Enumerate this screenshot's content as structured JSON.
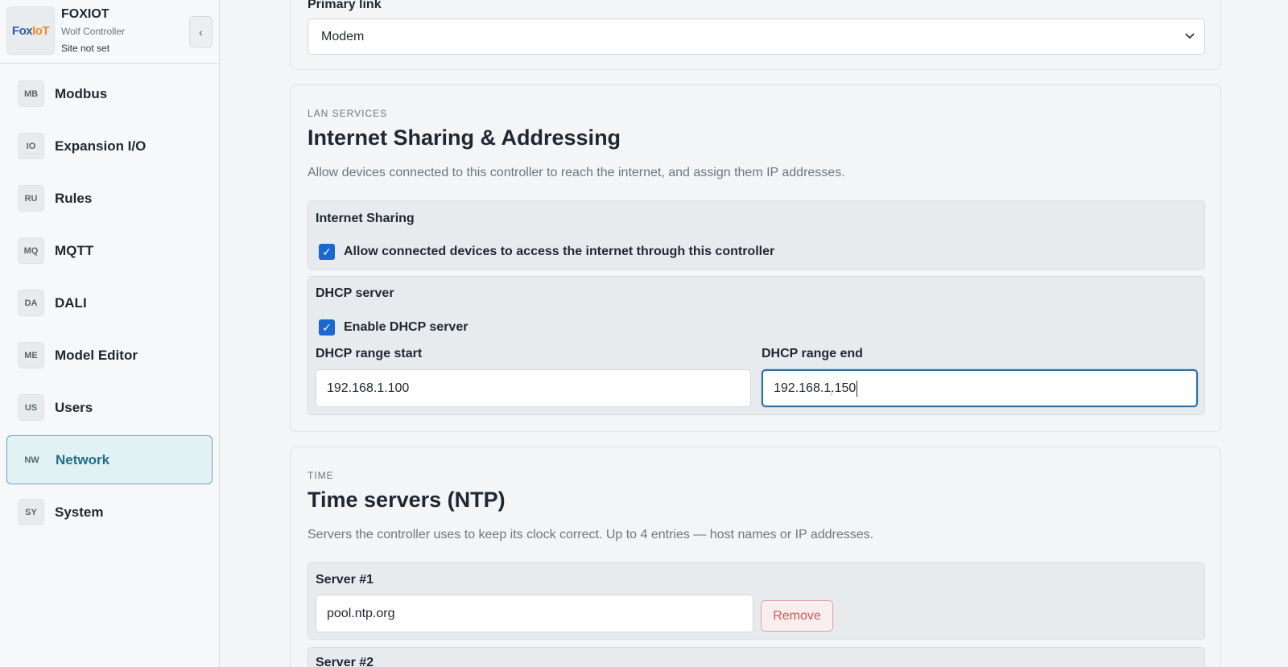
{
  "sidebar": {
    "brand": {
      "logo_part1": "Fox",
      "logo_part2": "IoT",
      "name": "FOXIOT",
      "subtitle": "Wolf Controller",
      "site": "Site not set",
      "collapse_icon": "‹"
    },
    "items": [
      {
        "abbr": "MB",
        "label": "Modbus"
      },
      {
        "abbr": "IO",
        "label": "Expansion I/O"
      },
      {
        "abbr": "RU",
        "label": "Rules"
      },
      {
        "abbr": "MQ",
        "label": "MQTT"
      },
      {
        "abbr": "DA",
        "label": "DALI"
      },
      {
        "abbr": "ME",
        "label": "Model Editor"
      },
      {
        "abbr": "US",
        "label": "Users"
      },
      {
        "abbr": "NW",
        "label": "Network"
      },
      {
        "abbr": "SY",
        "label": "System"
      }
    ],
    "active_item": "Network"
  },
  "primary_link": {
    "label": "Primary link",
    "selected": "Modem"
  },
  "lan": {
    "eyebrow": "LAN SERVICES",
    "title": "Internet Sharing & Addressing",
    "description": "Allow devices connected to this controller to reach the internet, and assign them IP addresses.",
    "sharing": {
      "title": "Internet Sharing",
      "checkbox_label": "Allow connected devices to access the internet through this controller",
      "checked": true
    },
    "dhcp": {
      "title": "DHCP server",
      "enable_label": "Enable DHCP server",
      "enabled": true,
      "range_start_label": "DHCP range start",
      "range_start_value": "192.168.1.100",
      "range_end_label": "DHCP range end",
      "range_end_value": "192.168.1.150"
    }
  },
  "time": {
    "eyebrow": "TIME",
    "title": "Time servers (NTP)",
    "description": "Servers the controller uses to keep its clock correct. Up to 4 entries — host names or IP addresses.",
    "servers": [
      {
        "label": "Server #1",
        "value": "pool.ntp.org",
        "remove_label": "Remove"
      },
      {
        "label": "Server #2"
      }
    ]
  },
  "colors": {
    "accent": "#1967d2",
    "active_nav_bg": "#e2f1f4",
    "active_nav_text": "#1f6f87",
    "danger": "#d05a5a"
  }
}
